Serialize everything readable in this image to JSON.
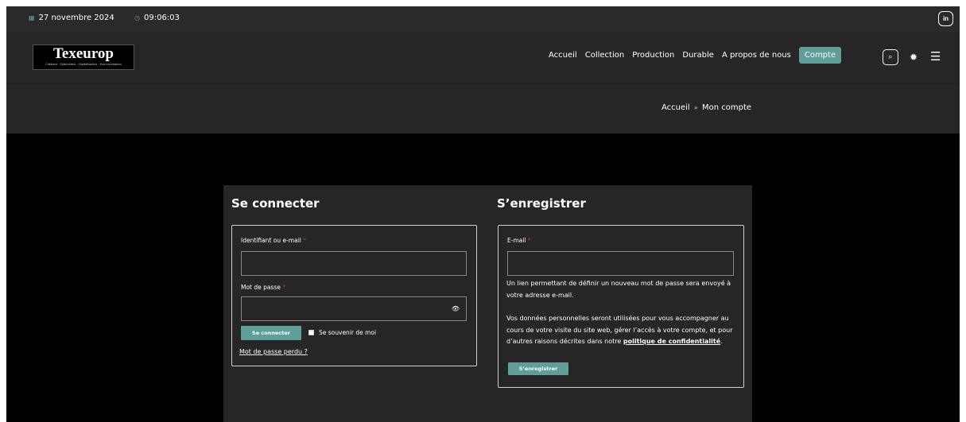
{
  "topbar": {
    "date": "27 novembre 2024",
    "time": "09:06:03",
    "linkedin_label": "in"
  },
  "header": {
    "logo_name": "Texeurop",
    "logo_tagline": "Créateur · Fabricateur · Digitalisateur · Eco-conception",
    "nav": [
      "Accueil",
      "Collection",
      "Production",
      "Durable",
      "A propos de nous"
    ],
    "nav_active": "Compte",
    "accent_color": "#5f9e99"
  },
  "breadcrumb": {
    "home": "Accueil",
    "separator": "»",
    "current": "Mon compte"
  },
  "login": {
    "title": "Se connecter",
    "username_label": "Identifiant ou e-mail",
    "password_label": "Mot de passe",
    "required_mark": "*",
    "submit_label": "Se connecter",
    "remember_label": "Se souvenir de moi",
    "lost_password": "Mot de passe perdu ?"
  },
  "register": {
    "title": "S’enregistrer",
    "email_label": "E-mail",
    "required_mark": "*",
    "info_text": "Un lien permettant de définir un nouveau mot de passe sera envoyé à votre adresse e-mail.",
    "privacy_text_before": "Vos données personnelles seront utilisées pour vous accompagner au cours de votre visite du site web, gérer l’accès à votre compte, et pour d’autres raisons décrites dans notre ",
    "privacy_link": "politique de confidentialité",
    "privacy_text_after": ".",
    "submit_label": "S’enregistrer"
  }
}
